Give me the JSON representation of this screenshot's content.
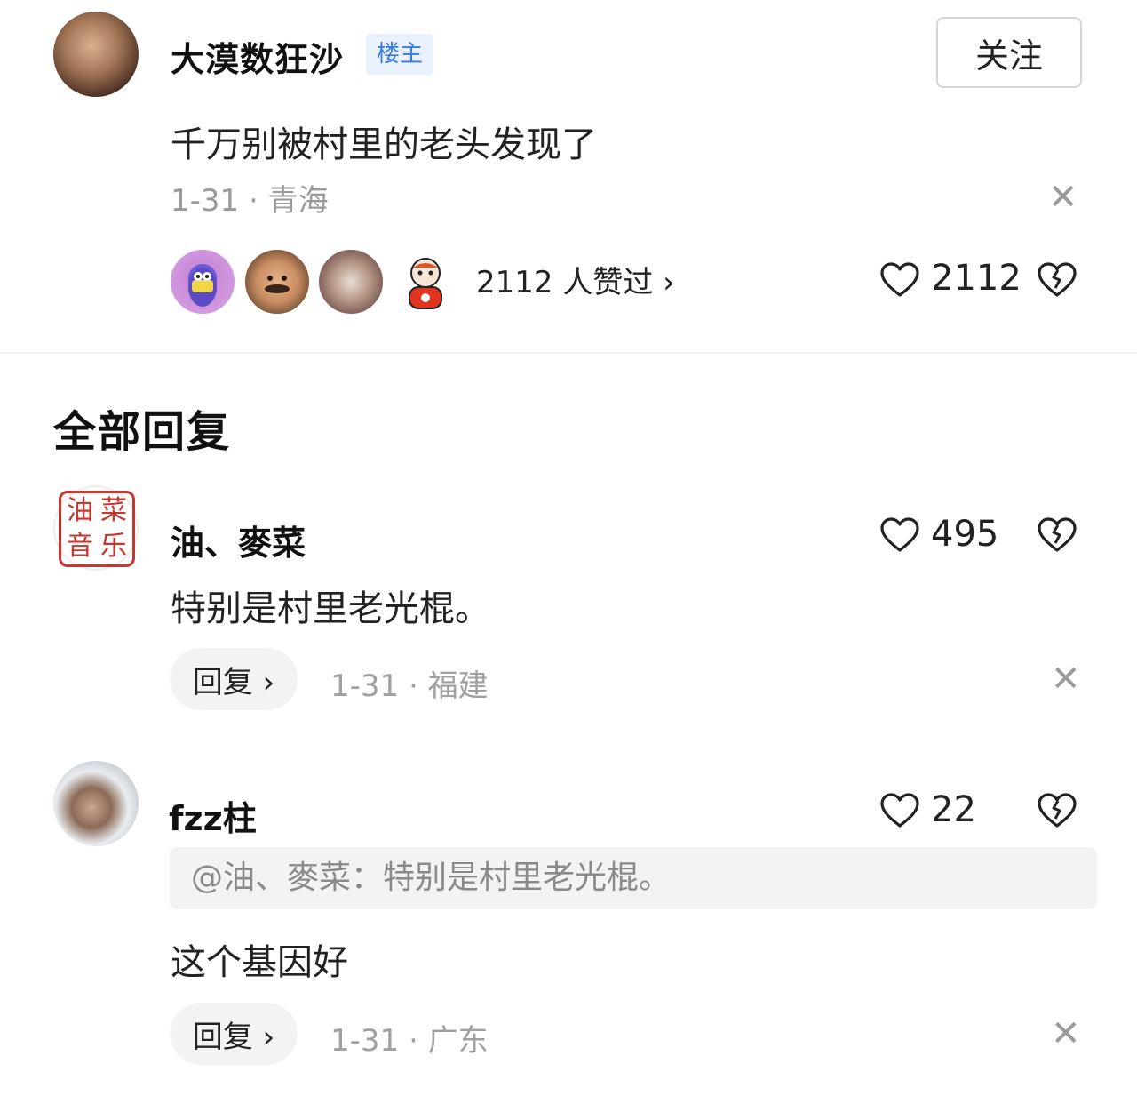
{
  "op": {
    "username": "大漠数狂沙",
    "badge": "楼主",
    "follow_label": "关注",
    "text": "千万别被村里的老头发现了",
    "meta": "1-31 · 青海",
    "likers_text": "2112 人赞过 ›",
    "like_count": "2112"
  },
  "section_title": "全部回复",
  "comments": [
    {
      "username": "油、麥菜",
      "avatar_stamp": [
        "油",
        "菜",
        "音",
        "乐"
      ],
      "text": "特别是村里老光棍。",
      "like_count": "495",
      "reply_label": "回复 ›",
      "meta": "1-31 · 福建"
    },
    {
      "username": "fzz柱",
      "quote": "@油、麥菜：特别是村里老光棍。",
      "text": "这个基因好",
      "like_count": "22",
      "reply_label": "回复 ›",
      "meta": "1-31 · 广东"
    }
  ],
  "icons": {
    "close": "close-icon",
    "heart": "heart-icon",
    "dislike": "broken-heart-icon"
  },
  "colors": {
    "badge_text": "#3a7be0",
    "badge_bg": "#e8f1fd",
    "stamp_red": "#c8372d",
    "meta_gray": "#9a9a9a"
  }
}
